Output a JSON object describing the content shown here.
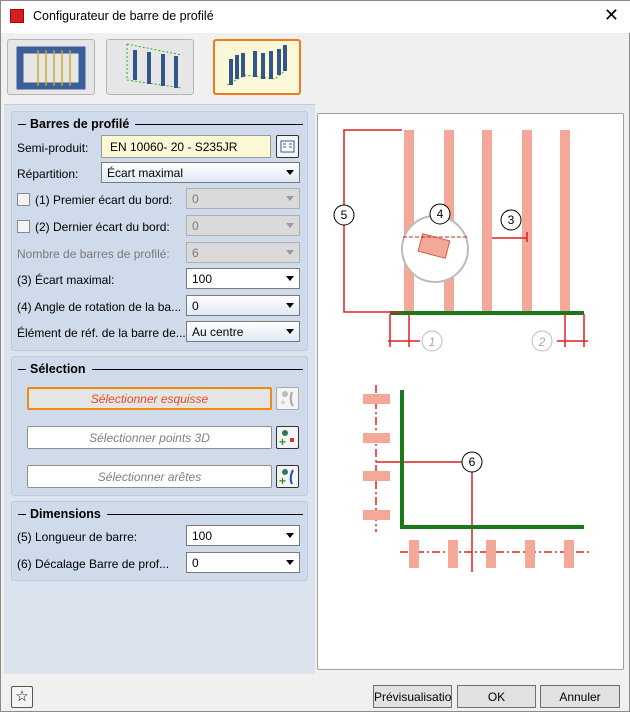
{
  "window": {
    "title": "Configurateur de barre de profilé"
  },
  "mode_tabs": [
    {
      "name": "frame-infill",
      "selected": false
    },
    {
      "name": "bars-between-lines",
      "selected": false
    },
    {
      "name": "bars-on-edge",
      "selected": true
    }
  ],
  "profile_bars": {
    "heading": "Barres de profilé",
    "semi_product_label": "Semi-produit:",
    "semi_product_value": "EN 10060- 20 - S235JR",
    "distribution_label": "Répartition:",
    "distribution_value": "Écart maximal",
    "first_edge_label": "(1) Premier écart du bord:",
    "first_edge_value": "0",
    "first_edge_checked": false,
    "last_edge_label": "(2) Dernier écart du bord:",
    "last_edge_value": "0",
    "last_edge_checked": false,
    "count_label": "Nombre de barres de profilé:",
    "count_value": "6",
    "max_gap_label": "(3) Écart maximal:",
    "max_gap_value": "100",
    "rotation_label": "(4) Angle de rotation de la ba...",
    "rotation_value": "0",
    "ref_label": "Élément de réf. de la barre de...",
    "ref_value": "Au centre"
  },
  "selection": {
    "heading": "Sélection",
    "sketch": "Sélectionner esquisse",
    "points": "Sélectionner points 3D",
    "edges": "Sélectionner arêtes"
  },
  "dimensions": {
    "heading": "Dimensions",
    "length_label": "(5) Longueur de barre:",
    "length_value": "100",
    "offset_label": "(6) Décalage Barre de prof...",
    "offset_value": "0"
  },
  "diagram": {
    "labels": [
      "1",
      "2",
      "3",
      "4",
      "5",
      "6"
    ],
    "bar_color": "#f4a898",
    "line_color": "#e02020",
    "base_color": "#1a7a1a"
  },
  "footer": {
    "preview": "Prévisualisatio",
    "ok": "OK",
    "cancel": "Annuler"
  }
}
